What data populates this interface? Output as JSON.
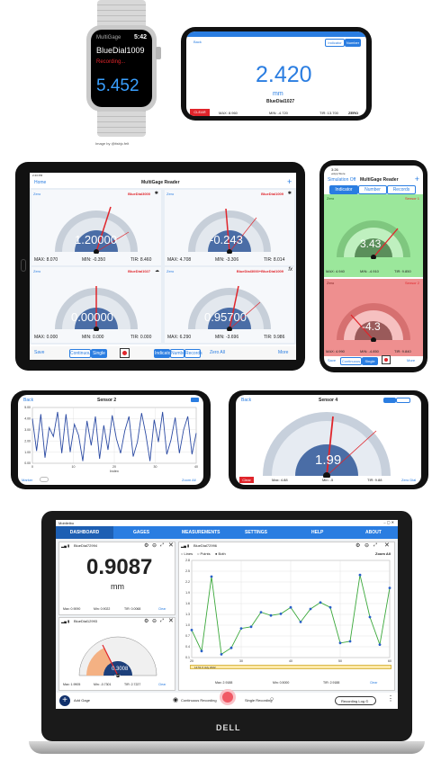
{
  "watch": {
    "app": "MultiGage",
    "time": "5:42",
    "device": "BlueDial1009",
    "status": "Recording...",
    "value": "5.452",
    "credit": "Image by @itsbjc.felt"
  },
  "phone_landscape": {
    "back": "Back",
    "seg_indicator": "Indicator",
    "seg_number": "Number",
    "value": "2.420",
    "unit": "mm",
    "device": "BlueDial1027",
    "clear": "CLEAR",
    "max": "MAX: 8.960",
    "min": "MIN: -4.720",
    "tir": "TIR: 13.700",
    "zero": "ZERO"
  },
  "tablet": {
    "time": "2:43 PM",
    "home": "Home",
    "title": "MultiGage Reader",
    "add": "+",
    "gages": [
      {
        "zero": "Zero",
        "name": "BlueDial3000",
        "value": "1.20000",
        "max": "MAX: 8.070",
        "min": "MIN: -0.350",
        "tir": "TIR: 8.460"
      },
      {
        "zero": "Zero",
        "name": "BlueDial1009",
        "value": "-0.243",
        "max": "MAX: 4.708",
        "min": "MIN: -3.306",
        "tir": "TIR: 8.014"
      },
      {
        "zero": "Zero",
        "name": "BlueDial1027",
        "value": "0.00000",
        "max": "MAX: 0.000",
        "min": "MIN: 0.000",
        "tir": "TIR: 0.000"
      },
      {
        "zero": "Zero",
        "name": "BlueDial3000+BlueDial1009",
        "value": "0.95700",
        "max": "MAX: 6.290",
        "min": "MIN: -3.696",
        "tir": "TIR: 9.986"
      }
    ],
    "save": "Save",
    "continuous": "Continuous",
    "single": "Single",
    "indicator": "Indicator",
    "number": "Number",
    "records": "Records",
    "zero_all": "Zero All",
    "more": "More"
  },
  "phone_portrait": {
    "time": "3:26",
    "store": "◂ App Store",
    "sim": "Simulation Off",
    "title": "MultiGage Reader",
    "tab_indicator": "Indicator",
    "tab_number": "Number",
    "tab_records": "Records",
    "s1_zero": "Zero",
    "s1_name": "Sensor 1",
    "s1_value": "3.43",
    "s1_max": "MAX: 4.940",
    "s1_min": "MIN: -4.910",
    "s1_tir": "TIR: 9.850",
    "s2_zero": "Zero",
    "s2_name": "Sensor 2",
    "s2_value": "-4.3",
    "s2_max": "MAX: 4.990",
    "s2_min": "MIN: -4.850",
    "s2_tir": "TIR: 9.840",
    "save": "Save",
    "continuous": "Continuous",
    "single": "Single",
    "more": "More"
  },
  "phone_chart": {
    "back": "Back",
    "title": "Sensor 2",
    "xlabel": "Index",
    "marker": "Marker",
    "zoom_all": "Zoom All"
  },
  "phone_sensor4": {
    "back": "Back",
    "title": "Sensor 4",
    "value": "1.99",
    "clear": "Clear",
    "max": "Max: 4.88",
    "min": "Min: -5",
    "tir": "TIR: 9.88",
    "zero": "Zero Dial"
  },
  "laptop": {
    "app": "Mobileibo",
    "nav": [
      "DASHBOARD",
      "GAGES",
      "MEASUREMENTS",
      "SETTINGS",
      "HELP",
      "ABOUT"
    ],
    "card1": {
      "name": "BlueDial72994",
      "value": "0.9087",
      "unit": "mm",
      "max": "Max: 0.9090",
      "min": "Min: 0.9022",
      "tir": "TIR: 0.0068",
      "clear": "Clear"
    },
    "card2": {
      "name": "BlueDial12993",
      "value": "0.3008",
      "unit": "mm",
      "max": "Max: 1.9905",
      "min": "Min: -0.7301",
      "tir": "TIR: 2.7227",
      "clear": "Clear"
    },
    "card3": {
      "name": "BlueDial72996",
      "opt_lines": "Lines",
      "opt_points": "Points",
      "opt_both": "Both",
      "zoom_all": "Zoom All",
      "date": "14:51 6 July 2022",
      "max": "Max: 2.9188",
      "min": "Min: 0.5000",
      "tir": "TIR: 2.9188",
      "clear": "Clear"
    },
    "add_gage": "Add Gage",
    "continuous": "Continuous Recording",
    "single": "Single Recording",
    "log": "Recording Log",
    "brand": "DELL"
  },
  "chart_data": [
    {
      "type": "line",
      "title": "Sensor 2",
      "xlabel": "Index",
      "ylabel": "",
      "xlim": [
        0,
        42
      ],
      "ylim": [
        0,
        5
      ],
      "x_ticks": [
        "0",
        "10",
        "20",
        "30",
        "40"
      ],
      "y_ticks": [
        "0.00",
        "1.00",
        "2.00",
        "3.00",
        "4.00",
        "5.00"
      ],
      "series": [
        {
          "values": [
            4.0,
            1.1,
            4.4,
            0.5,
            3.2,
            2.4,
            4.6,
            0.9,
            4.4,
            1.0,
            3.5,
            2.5,
            0.2,
            3.8,
            1.6,
            4.2,
            0.4,
            3.4,
            1.2,
            4.3,
            2.2,
            0.9,
            2.9,
            4.2,
            0.6,
            1.9,
            4.5,
            2.6,
            0.2,
            3.9,
            1.9,
            4.6,
            0.8,
            2.1,
            4.1,
            0.9,
            3.0,
            4.2,
            0.8,
            2.7
          ]
        }
      ],
      "grid": true
    },
    {
      "type": "line",
      "title": "",
      "xlabel": "",
      "ylabel": "",
      "xlim": [
        0,
        25
      ],
      "ylim": [
        0,
        3
      ],
      "x_ticks": [
        "20",
        "30",
        "40",
        "50",
        "60"
      ],
      "y_ticks": [
        "0.1",
        "0.4",
        "0.7",
        "1.0",
        "1.3",
        "1.6",
        "1.9",
        "2.2",
        "2.5",
        "2.8"
      ],
      "series": [
        {
          "values": [
            0.85,
            0.2,
            2.5,
            0.1,
            0.3,
            0.9,
            0.95,
            1.4,
            1.3,
            1.35,
            1.55,
            1.1,
            1.5,
            1.7,
            1.55,
            0.45,
            0.5,
            2.55,
            1.25,
            0.4,
            2.15
          ]
        }
      ],
      "grid": true
    }
  ]
}
